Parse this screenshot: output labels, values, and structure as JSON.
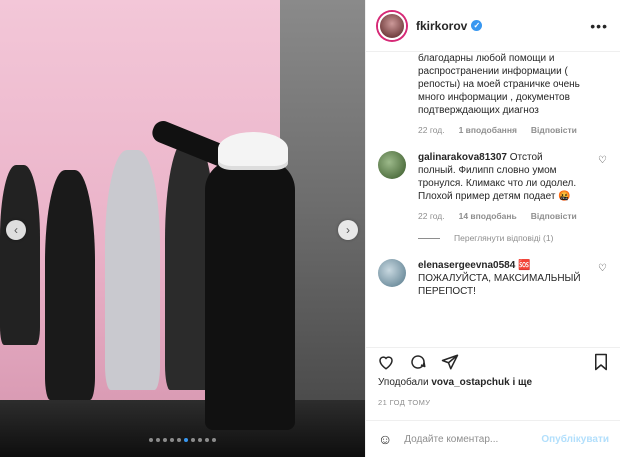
{
  "post": {
    "username": "fkirkorov",
    "more_label": "•••"
  },
  "caption": {
    "text": "благодарны любой помощи и распространении информации ( репосты) на моей страничке очень много информации , документов подтверждающих диагноз",
    "time": "22 год.",
    "likes": "1 вподобання",
    "reply": "Відповісти"
  },
  "comments": [
    {
      "user": "galinarakova81307",
      "text": "Отстой полный. Филипп словно умом тронулся. Климакс что ли одолел. Плохой пример детям подает",
      "trailing": "🤬",
      "time": "22 год.",
      "likes": "14 вподобань",
      "reply": "Відповісти",
      "view_replies": "Переглянути відповіді (1)",
      "avatar_color": "#5a7a4a"
    },
    {
      "user": "elenasergeevna0584",
      "text": "ПОЖАЛУЙСТА, МАКСИМАЛЬНЫЙ ПЕРЕПОСТ!",
      "trailing": "🆘",
      "avatar_color": "#8aa6b8"
    }
  ],
  "actions": {
    "like_icon": "heart-icon",
    "comment_icon": "comment-icon",
    "share_icon": "share-icon",
    "save_icon": "bookmark-icon"
  },
  "likes_line": {
    "prefix": "Уподобали",
    "user": "vova_ostapchuk",
    "suffix": "і ще"
  },
  "timestamp": "21 ГОД ТОМУ",
  "composer": {
    "placeholder": "Додайте коментар...",
    "post_label": "Опублікувати"
  },
  "carousel": {
    "prev": "‹",
    "next": "›",
    "slide_count": 10,
    "active_index": 5
  },
  "colors": {
    "accent": "#3897f0",
    "verified": "#3897f0",
    "post_disabled": "#b2dffc"
  }
}
